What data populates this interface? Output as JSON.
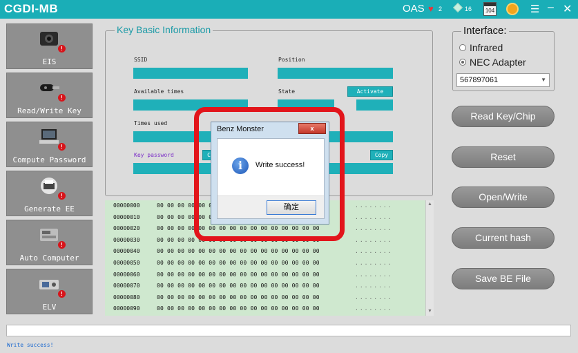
{
  "titlebar": {
    "title": "CGDI-MB",
    "oas": "OAS",
    "heart_count": "2",
    "diamond_count": "16",
    "calendar_num": "104"
  },
  "nav": {
    "items": [
      {
        "label": "EIS"
      },
      {
        "label": "Read/Write Key"
      },
      {
        "label": "Compute Password"
      },
      {
        "label": "Generate EE"
      },
      {
        "label": "Auto Computer"
      },
      {
        "label": "ELV"
      }
    ]
  },
  "key_info": {
    "group_title": "Key Basic Information",
    "ssid_label": "SSID",
    "position_label": "Position",
    "available_label": "Available times",
    "state_label": "State",
    "activate_label": "Activate",
    "times_used_label": "Times used",
    "key_password_label": "Key password",
    "copy_label": "Copy",
    "copy_left_label": "Co"
  },
  "hex": {
    "rows": [
      {
        "addr": "00000000",
        "bytes": "00 00 00 00 00 00 00 00 00 00 00 00 00 00 00 00",
        "ascii": "........"
      },
      {
        "addr": "00000010",
        "bytes": "00 00 00 00 00 00 00 00 00 00 00 00 00 00 00 00",
        "ascii": "........"
      },
      {
        "addr": "00000020",
        "bytes": "00 00 00 00 00 00 00 00 00 00 00 00 00 00 00 00",
        "ascii": "........"
      },
      {
        "addr": "00000030",
        "bytes": "00 00 00 00 00 00 00 00 00 00 00 00 00 00 00 00",
        "ascii": "........"
      },
      {
        "addr": "00000040",
        "bytes": "00 00 00 00 00 00 00 00 00 00 00 00 00 00 00 00",
        "ascii": "........"
      },
      {
        "addr": "00000050",
        "bytes": "00 00 00 00 00 00 00 00 00 00 00 00 00 00 00 00",
        "ascii": "........"
      },
      {
        "addr": "00000060",
        "bytes": "00 00 00 00 00 00 00 00 00 00 00 00 00 00 00 00",
        "ascii": "........"
      },
      {
        "addr": "00000070",
        "bytes": "00 00 00 00 00 00 00 00 00 00 00 00 00 00 00 00",
        "ascii": "........"
      },
      {
        "addr": "00000080",
        "bytes": "00 00 00 00 00 00 00 00 00 00 00 00 00 00 00 00",
        "ascii": "........"
      },
      {
        "addr": "00000090",
        "bytes": "00 00 00 00 00 00 00 00 00 00 00 00 00 00 00 00",
        "ascii": "........"
      }
    ]
  },
  "interface": {
    "title": "Interface:",
    "option_infrared": "Infrared",
    "option_nec": "NEC Adapter",
    "selected": "NEC Adapter",
    "device_value": "567897061"
  },
  "buttons": {
    "read_key": "Read Key/Chip",
    "reset": "Reset",
    "open_write": "Open/Write",
    "current_hash": "Current hash",
    "save_be": "Save BE File"
  },
  "status": {
    "text": "Write success!"
  },
  "dialog": {
    "title": "Benz Monster",
    "close_glyph": "x",
    "message": "Write success!",
    "ok_label": "确定"
  },
  "colors": {
    "titlebar": "#1aaeb7",
    "field": "#1fb0b9",
    "nav_tile": "#8f8f8f",
    "hex_bg": "#cfe8cf",
    "highlight": "#e2151b"
  }
}
